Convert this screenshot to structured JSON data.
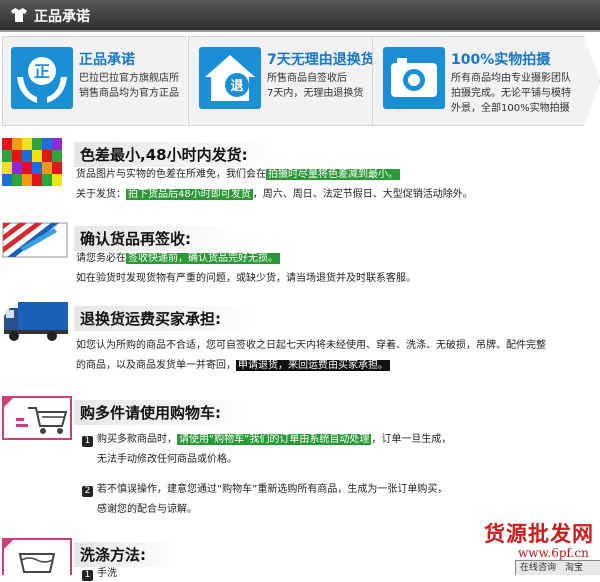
{
  "header": {
    "title": "正品承诺"
  },
  "promises": [
    {
      "title": "正品承诺",
      "icon_char": "正",
      "lines": [
        "巴拉巴拉官方旗舰店所",
        "销售商品均为官方正品"
      ]
    },
    {
      "title": "7天无理由退换货",
      "icon_char": "退",
      "lines": [
        "所售商品自签收后",
        "7天内，无理由退换货"
      ]
    },
    {
      "title": "100%实物拍摄",
      "lines": [
        "所有商品均由专业摄影团队",
        "拍摄完成。无论平铺与模特",
        "外景，全部100%实物拍摄"
      ]
    }
  ],
  "sections": {
    "color": {
      "title": "色差最小,48小时内发货:",
      "line1_pre": "货品图片与实物的色差在所难免，我们会在",
      "line1_hl": "拍摄时尽量将色差减到最小。",
      "line2_pre": "关于发货：",
      "line2_hl": "拍下货品后48小时即可发货",
      "line2_post": "，周六、周日、法定节假日、大型促销活动除外。"
    },
    "sign": {
      "title": "确认货品再签收:",
      "line1_pre": "请您务必在",
      "line1_hl": "签收快递前，确认货品完好无损。",
      "line2": "如在验货时发现货物有严重的问题，或缺少货，请当场退货并及时联系客服。"
    },
    "shipping": {
      "title": "退换货运费买家承担:",
      "line1": "如您认为所购的商品不合适，您可自签收之日起七天内将未经使用、穿着、洗涤、无破损，吊牌、配件完整",
      "line2_pre": "的商品，以及商品发货单一并寄回，",
      "line2_hl": "申请退货，来回运费由买家承担。"
    },
    "cart": {
      "title": "购多件请使用购物车:",
      "item1_num": "1",
      "item1_pre": "购买多款商品时，",
      "item1_hl": "请使用“购物车”我们的订单由系统自动处理",
      "item1_post": "，订单一旦生成，",
      "item1_line2": "无法手动修改任何商品或价格。",
      "item2_num": "2",
      "item2_line1": "若不慎误操作，建意您通过“购物车”重新选购所有商品，生成为一张订单购买，",
      "item2_line2": "感谢您的配合与谅解。"
    },
    "wash": {
      "title": "洗涤方法:",
      "item1_num": "1",
      "item1_text": "手洗"
    }
  },
  "watermark": {
    "text": "货源批发网",
    "url": "www.6pf.cn"
  },
  "chat": {
    "label1": "在线咨询",
    "label2": "淘宝"
  }
}
